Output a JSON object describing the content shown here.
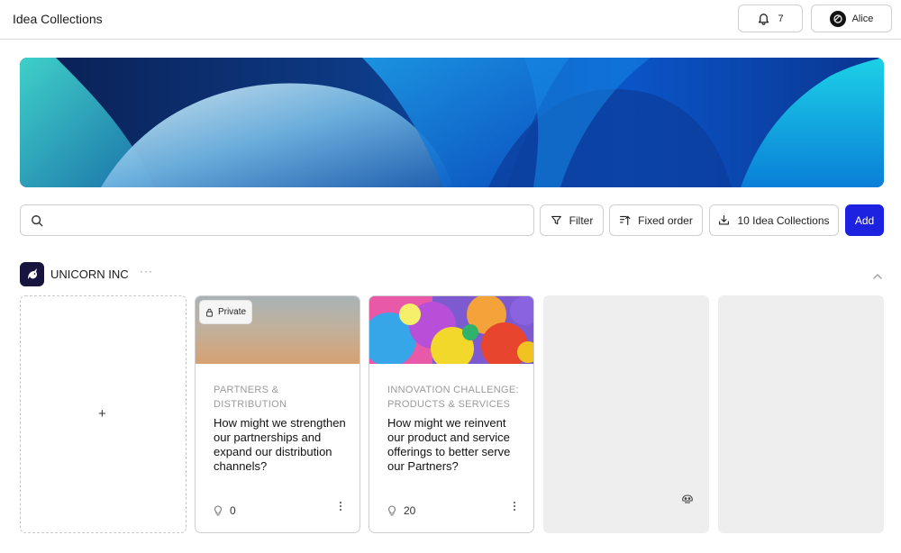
{
  "header": {
    "title": "Idea Collections",
    "notifications_count": "7",
    "user_name": "Alice"
  },
  "toolbar": {
    "search_placeholder": "",
    "filter_label": "Filter",
    "order_label": "Fixed order",
    "collections_label": "10 Idea Collections",
    "add_label": "Add"
  },
  "section": {
    "org_name": "UNICORN INC",
    "more_label": "···",
    "add_label": "+"
  },
  "cards": [
    {
      "badge": "Private",
      "category": "PARTNERS & DISTRIBUTION",
      "title": "How might we strengthen our partnerships and expand our distribution channels?",
      "count": "0"
    },
    {
      "category": "INNOVATION CHALLENGE: PRODUCTS & SERVICES",
      "title": "How might we reinvent our product and service offerings to better serve our Partners?",
      "count": "20"
    }
  ],
  "colors": {
    "accent": "#1d22e0",
    "org_logo_bg": "#17153e"
  }
}
